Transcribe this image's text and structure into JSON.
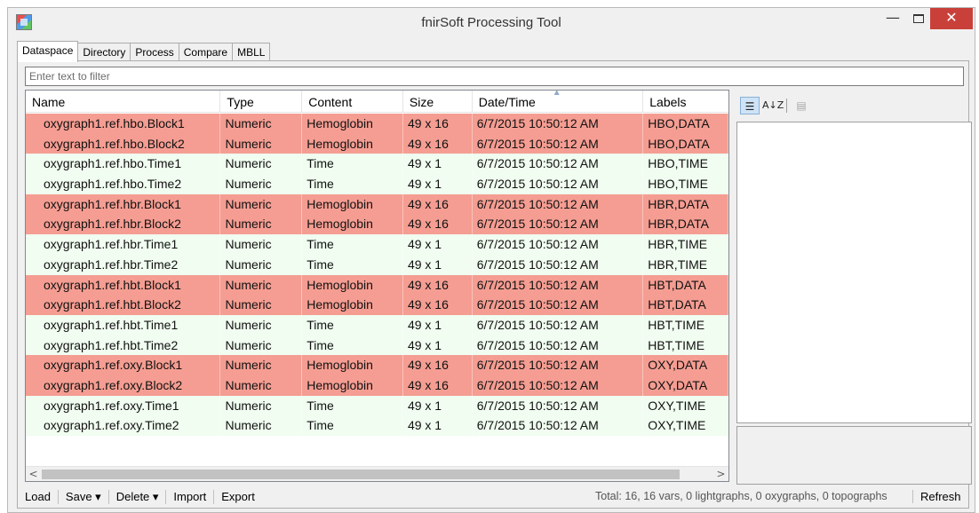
{
  "window": {
    "title": "fnirSoft Processing Tool",
    "minimize_glyph": "—",
    "close_glyph": "✕"
  },
  "tabs": [
    "Dataspace",
    "Directory",
    "Process",
    "Compare",
    "MBLL"
  ],
  "filter": {
    "placeholder": "Enter text to filter"
  },
  "grid": {
    "columns": [
      "Name",
      "Type",
      "Content",
      "Size",
      "Date/Time",
      "Labels"
    ],
    "sorted_column": "Date/Time",
    "rows": [
      {
        "name": "oxygraph1.ref.hbo.Block1",
        "type": "Numeric",
        "content": "Hemoglobin",
        "size": "49 x 16",
        "datetime": "6/7/2015 10:50:12 AM",
        "labels": "HBO,DATA",
        "kind": "data"
      },
      {
        "name": "oxygraph1.ref.hbo.Block2",
        "type": "Numeric",
        "content": "Hemoglobin",
        "size": "49 x 16",
        "datetime": "6/7/2015 10:50:12 AM",
        "labels": "HBO,DATA",
        "kind": "data"
      },
      {
        "name": "oxygraph1.ref.hbo.Time1",
        "type": "Numeric",
        "content": "Time",
        "size": "49 x 1",
        "datetime": "6/7/2015 10:50:12 AM",
        "labels": "HBO,TIME",
        "kind": "time"
      },
      {
        "name": "oxygraph1.ref.hbo.Time2",
        "type": "Numeric",
        "content": "Time",
        "size": "49 x 1",
        "datetime": "6/7/2015 10:50:12 AM",
        "labels": "HBO,TIME",
        "kind": "time"
      },
      {
        "name": "oxygraph1.ref.hbr.Block1",
        "type": "Numeric",
        "content": "Hemoglobin",
        "size": "49 x 16",
        "datetime": "6/7/2015 10:50:12 AM",
        "labels": "HBR,DATA",
        "kind": "data"
      },
      {
        "name": "oxygraph1.ref.hbr.Block2",
        "type": "Numeric",
        "content": "Hemoglobin",
        "size": "49 x 16",
        "datetime": "6/7/2015 10:50:12 AM",
        "labels": "HBR,DATA",
        "kind": "data"
      },
      {
        "name": "oxygraph1.ref.hbr.Time1",
        "type": "Numeric",
        "content": "Time",
        "size": "49 x 1",
        "datetime": "6/7/2015 10:50:12 AM",
        "labels": "HBR,TIME",
        "kind": "time"
      },
      {
        "name": "oxygraph1.ref.hbr.Time2",
        "type": "Numeric",
        "content": "Time",
        "size": "49 x 1",
        "datetime": "6/7/2015 10:50:12 AM",
        "labels": "HBR,TIME",
        "kind": "time"
      },
      {
        "name": "oxygraph1.ref.hbt.Block1",
        "type": "Numeric",
        "content": "Hemoglobin",
        "size": "49 x 16",
        "datetime": "6/7/2015 10:50:12 AM",
        "labels": "HBT,DATA",
        "kind": "data"
      },
      {
        "name": "oxygraph1.ref.hbt.Block2",
        "type": "Numeric",
        "content": "Hemoglobin",
        "size": "49 x 16",
        "datetime": "6/7/2015 10:50:12 AM",
        "labels": "HBT,DATA",
        "kind": "data"
      },
      {
        "name": "oxygraph1.ref.hbt.Time1",
        "type": "Numeric",
        "content": "Time",
        "size": "49 x 1",
        "datetime": "6/7/2015 10:50:12 AM",
        "labels": "HBT,TIME",
        "kind": "time"
      },
      {
        "name": "oxygraph1.ref.hbt.Time2",
        "type": "Numeric",
        "content": "Time",
        "size": "49 x 1",
        "datetime": "6/7/2015 10:50:12 AM",
        "labels": "HBT,TIME",
        "kind": "time"
      },
      {
        "name": "oxygraph1.ref.oxy.Block1",
        "type": "Numeric",
        "content": "Hemoglobin",
        "size": "49 x 16",
        "datetime": "6/7/2015 10:50:12 AM",
        "labels": "OXY,DATA",
        "kind": "data"
      },
      {
        "name": "oxygraph1.ref.oxy.Block2",
        "type": "Numeric",
        "content": "Hemoglobin",
        "size": "49 x 16",
        "datetime": "6/7/2015 10:50:12 AM",
        "labels": "OXY,DATA",
        "kind": "data"
      },
      {
        "name": "oxygraph1.ref.oxy.Time1",
        "type": "Numeric",
        "content": "Time",
        "size": "49 x 1",
        "datetime": "6/7/2015 10:50:12 AM",
        "labels": "OXY,TIME",
        "kind": "time"
      },
      {
        "name": "oxygraph1.ref.oxy.Time2",
        "type": "Numeric",
        "content": "Time",
        "size": "49 x 1",
        "datetime": "6/7/2015 10:50:12 AM",
        "labels": "OXY,TIME",
        "kind": "time"
      }
    ],
    "scroll_left_glyph": "<",
    "scroll_right_glyph": ">"
  },
  "propgrid": {
    "categorized_glyph": "☰",
    "alphabetical_glyph": "A↓Z",
    "pages_glyph": "▤"
  },
  "bottombar": {
    "load": "Load",
    "save": "Save ▾",
    "delete": "Delete ▾",
    "import": "Import",
    "export": "Export",
    "status": "Total: 16, 16 vars, 0 lightgraphs, 0 oxygraphs, 0 topographs",
    "refresh": "Refresh"
  },
  "colors": {
    "data_row": "#f59d92",
    "time_row": "#f0fdf0",
    "close_button": "#c9403a"
  }
}
